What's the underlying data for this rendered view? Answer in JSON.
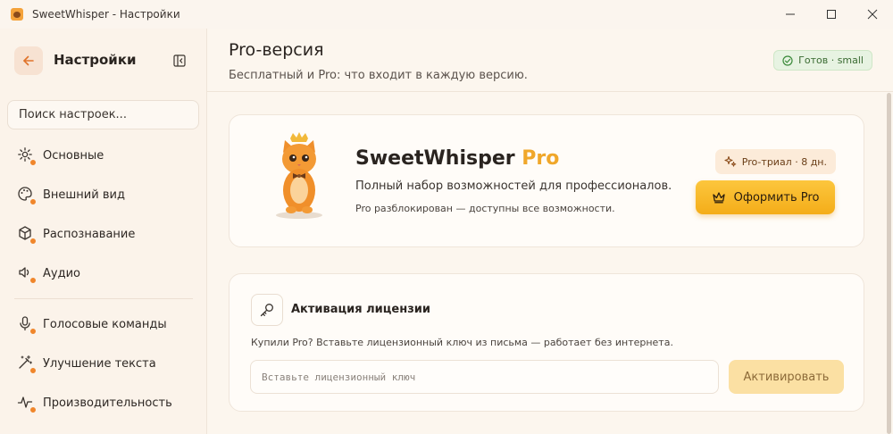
{
  "window": {
    "title": "SweetWhisper - Настройки"
  },
  "sidebar": {
    "title": "Настройки",
    "search_placeholder": "Поиск настроек...",
    "items": [
      {
        "label": "Основные",
        "icon": "gear-icon"
      },
      {
        "label": "Внешний вид",
        "icon": "palette-icon"
      },
      {
        "label": "Распознавание",
        "icon": "cube-icon"
      },
      {
        "label": "Аудио",
        "icon": "speaker-icon"
      },
      {
        "label": "Голосовые команды",
        "icon": "microphone-icon"
      },
      {
        "label": "Улучшение текста",
        "icon": "magic-wand-icon"
      },
      {
        "label": "Производительность",
        "icon": "pulse-icon"
      }
    ]
  },
  "header": {
    "title": "Pro-версия",
    "subtitle": "Бесплатный и Pro: что входит в каждую версию.",
    "status_badge": "Готов · small"
  },
  "pro_card": {
    "title_main": "SweetWhisper",
    "title_accent": "Pro",
    "description": "Полный набор возможностей для профессионалов.",
    "note": "Pro разблокирован — доступны все возможности.",
    "trial_badge": "Pro-триал · 8 дн.",
    "button_label": "Оформить Pro"
  },
  "license_card": {
    "title": "Активация лицензии",
    "description": "Купили Pro? Вставьте лицензионный ключ из письма — работает без интернета.",
    "input_placeholder": "Вставьте лицензионный ключ",
    "input_value": "",
    "button_label": "Активировать"
  },
  "colors": {
    "accent": "#f0a72a",
    "accent_button": "#f4ad19",
    "status_green": "#3a6b32",
    "nav_dot": "#f0862b"
  }
}
